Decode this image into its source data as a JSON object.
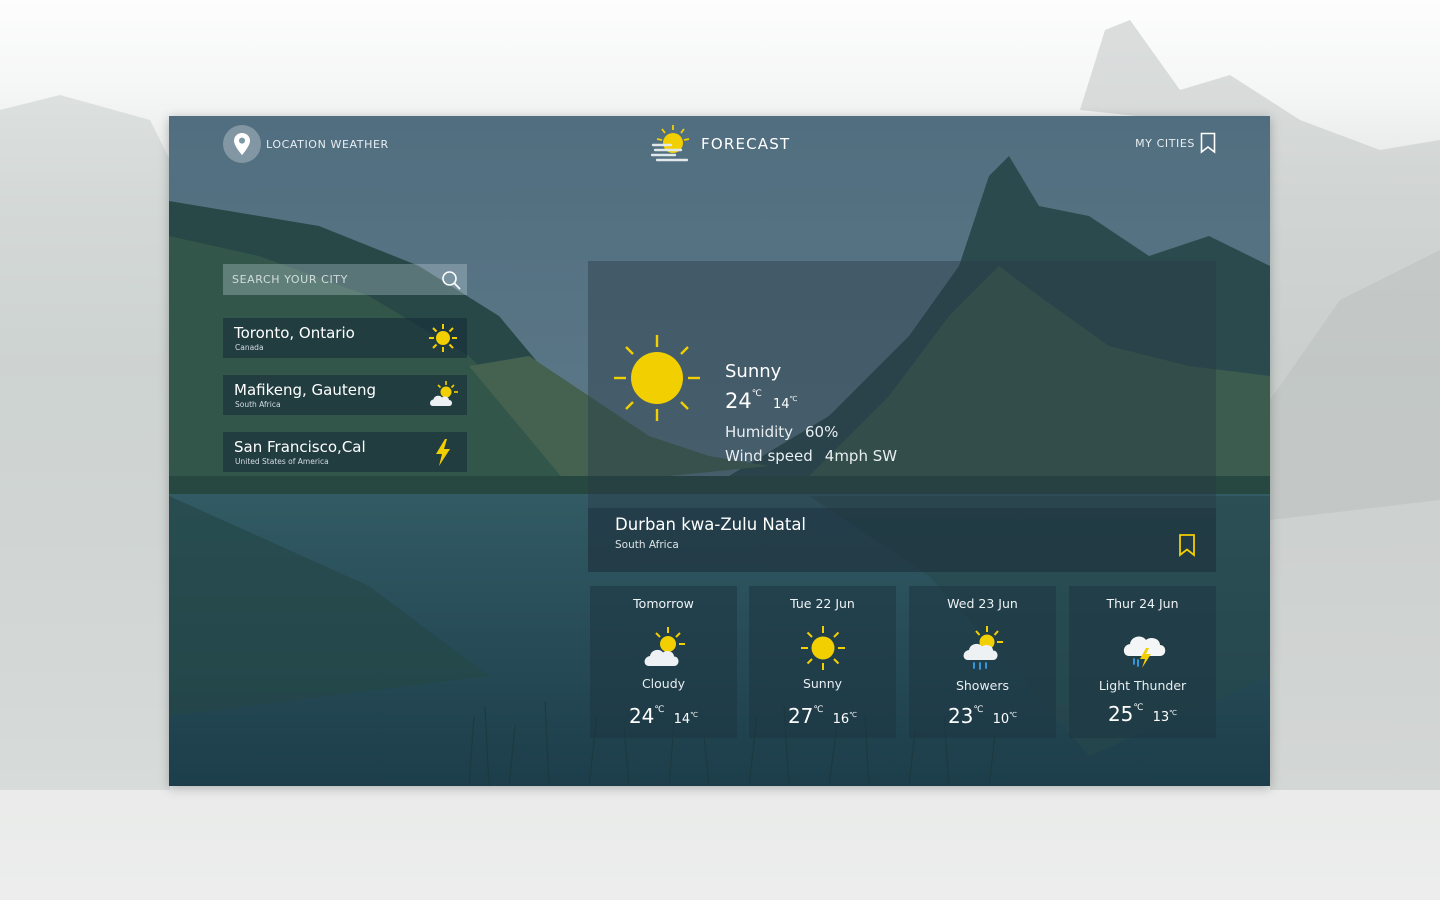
{
  "header": {
    "location_label": "LOCATION WEATHER",
    "brand_title": "FORECAST",
    "my_cities_label": "MY CITIES"
  },
  "search": {
    "placeholder": "SEARCH YOUR CITY"
  },
  "cities": [
    {
      "name": "Toronto, Ontario",
      "country": "Canada",
      "icon": "sun-icon"
    },
    {
      "name": "Mafikeng, Gauteng",
      "country": "South Africa",
      "icon": "partly-cloudy-icon"
    },
    {
      "name": "San Francisco,Cal",
      "country": "United States of America",
      "icon": "lightning-icon"
    }
  ],
  "current": {
    "condition": "Sunny",
    "temp_high": "24",
    "temp_low": "14",
    "unit": "℃",
    "humidity_label": "Humidity",
    "humidity_value": "60%",
    "wind_label": "Wind speed",
    "wind_value": "4mph SW",
    "location_name": "Durban kwa-Zulu Natal",
    "location_country": "South Africa",
    "icon": "sun-icon"
  },
  "forecast": [
    {
      "day": "Tomorrow",
      "condition": "Cloudy",
      "high": "24",
      "low": "14",
      "icon": "partly-cloudy-icon"
    },
    {
      "day": "Tue 22 Jun",
      "condition": "Sunny",
      "high": "27",
      "low": "16",
      "icon": "sun-icon"
    },
    {
      "day": "Wed 23 Jun",
      "condition": "Showers",
      "high": "23",
      "low": "10",
      "icon": "rain-showers-icon"
    },
    {
      "day": "Thur 24 Jun",
      "condition": "Light Thunder",
      "high": "25",
      "low": "13",
      "icon": "thunder-cloud-icon"
    }
  ],
  "colors": {
    "accent_yellow": "#f2cf00",
    "panel_tint": "#2a4b5a"
  }
}
